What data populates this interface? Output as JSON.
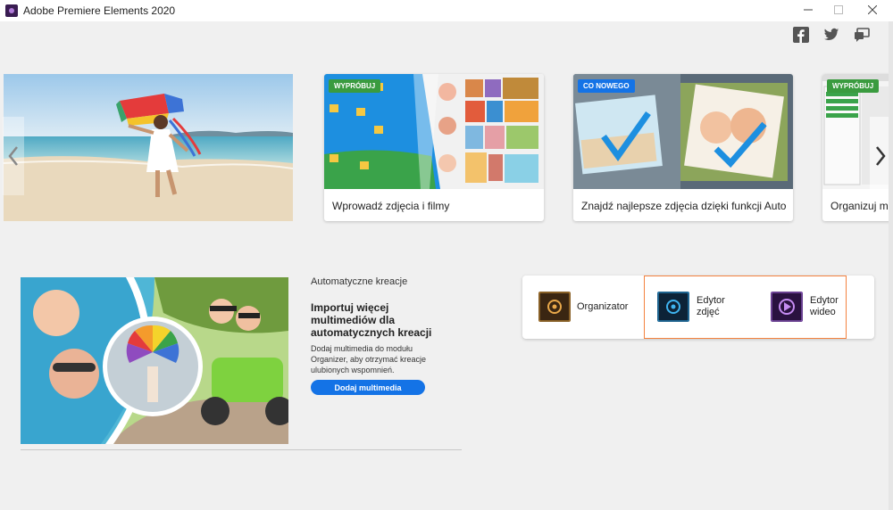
{
  "window": {
    "title": "Adobe Premiere Elements 2020",
    "minimize_icon": "minimize-icon",
    "maximize_icon": "maximize-icon",
    "close_icon": "close-icon"
  },
  "social": [
    "facebook-icon",
    "twitter-icon",
    "feedback-icon"
  ],
  "carousel": {
    "cards": [
      {
        "badge": "WYPRÓBUJ",
        "caption": "Wprowadź zdjęcia i filmy",
        "badge_color": "#3a9b3f"
      },
      {
        "badge": "CO NOWEGO",
        "caption": "Znajdź najlepsze zdjęcia dzięki funkcji Auto...",
        "badge_color": "#1473e6"
      },
      {
        "badge": "WYPRÓBUJ",
        "caption": "Organizuj ma",
        "badge_color": "#3a9b3f"
      }
    ]
  },
  "auto_creations": {
    "title": "Automatyczne kreacje",
    "heading": "Importuj więcej multimediów dla automatycznych kreacji",
    "description": "Dodaj multimedia do modułu Organizer, aby otrzymać kreacje ulubionych wspomnień.",
    "button": "Dodaj multimedia"
  },
  "launcher": {
    "organizer": "Organizator",
    "photo_editor": "Edytor zdjęć",
    "video_editor": "Edytor wideo"
  },
  "colors": {
    "accent": "#1473e6",
    "highlight": "#f4823f"
  }
}
